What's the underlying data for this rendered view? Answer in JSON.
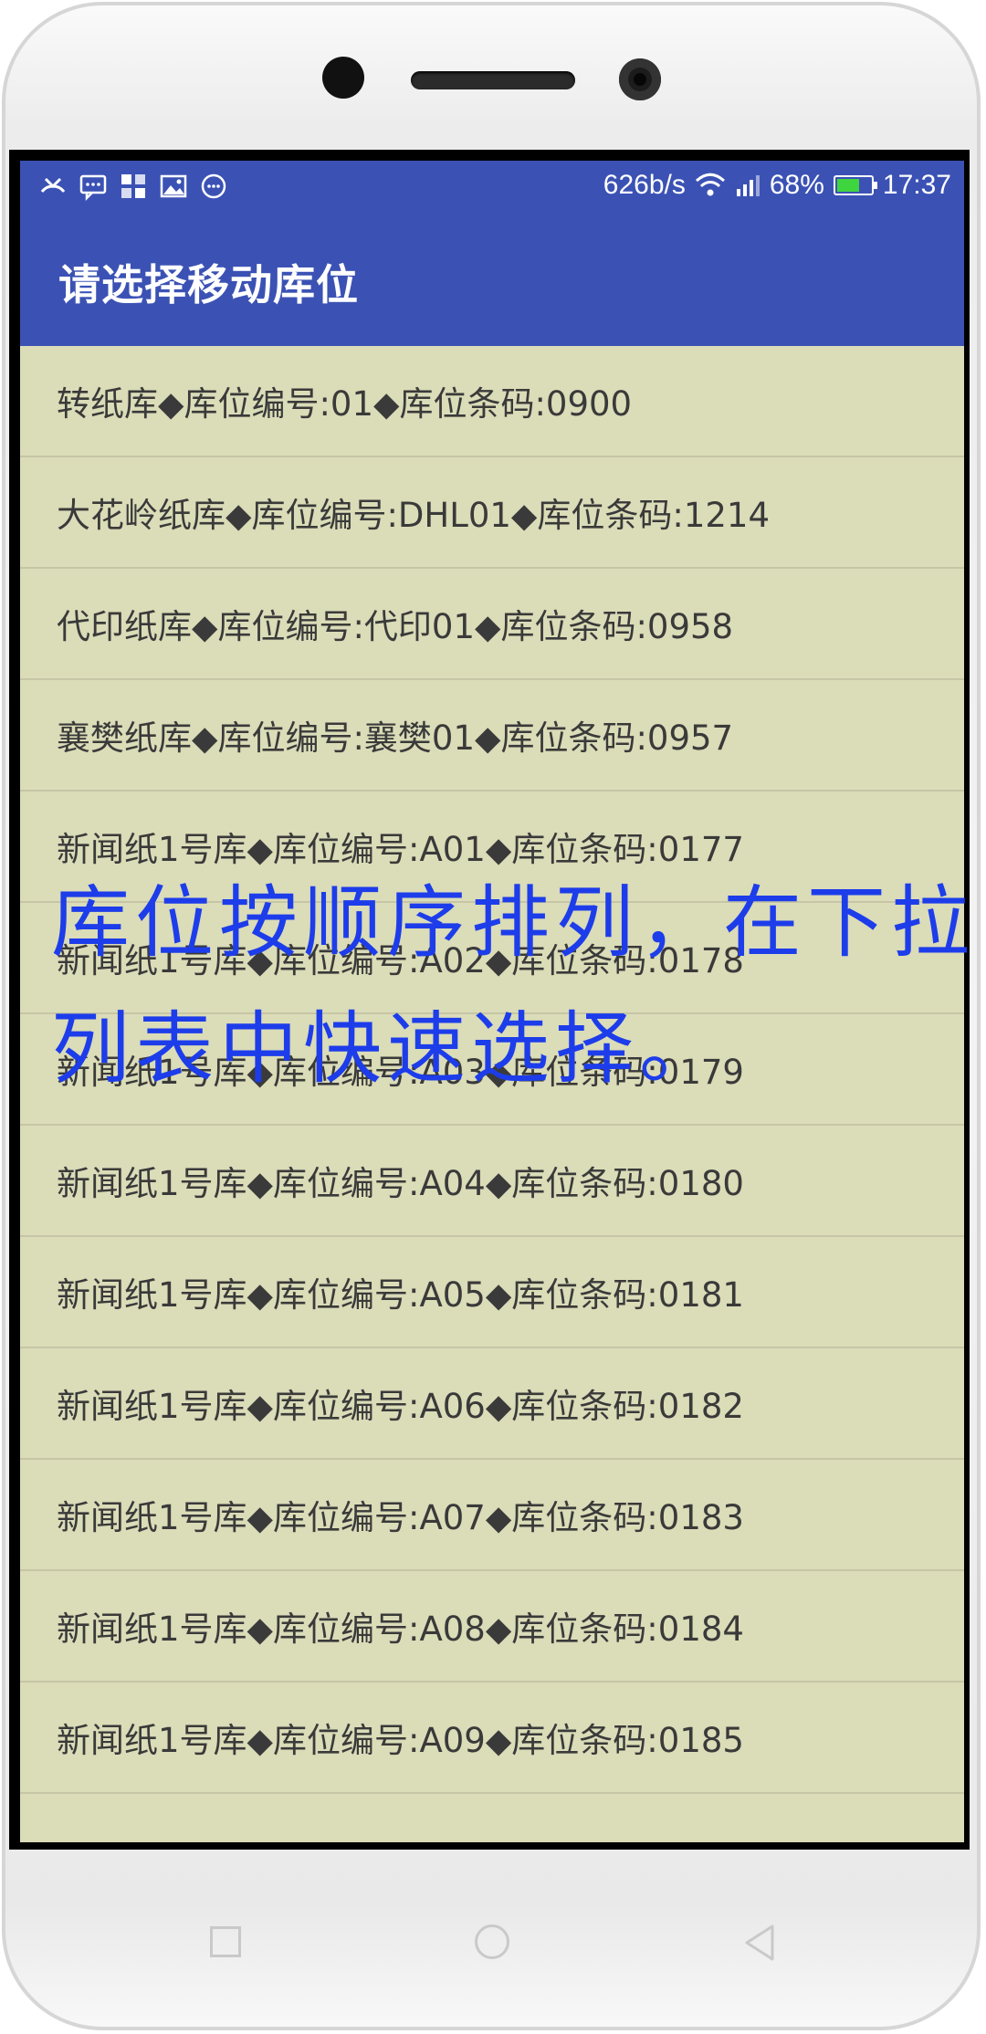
{
  "status_bar": {
    "net_speed": "626b/s",
    "battery": "68%",
    "battery_level": 0.68,
    "time": "17:37",
    "icons": [
      "missed-call-icon",
      "message-icon",
      "app-grid-icon",
      "image-icon",
      "more-icon",
      "wifi-icon",
      "signal-icon",
      "battery-icon"
    ]
  },
  "app_bar": {
    "title": "请选择移动库位"
  },
  "list": {
    "items": [
      "转纸库◆库位编号:01◆库位条码:0900",
      "大花岭纸库◆库位编号:DHL01◆库位条码:1214",
      "代印纸库◆库位编号:代印01◆库位条码:0958",
      "襄樊纸库◆库位编号:襄樊01◆库位条码:0957",
      "新闻纸1号库◆库位编号:A01◆库位条码:0177",
      "新闻纸1号库◆库位编号:A02◆库位条码:0178",
      "新闻纸1号库◆库位编号:A03◆库位条码:0179",
      "新闻纸1号库◆库位编号:A04◆库位条码:0180",
      "新闻纸1号库◆库位编号:A05◆库位条码:0181",
      "新闻纸1号库◆库位编号:A06◆库位条码:0182",
      "新闻纸1号库◆库位编号:A07◆库位条码:0183",
      "新闻纸1号库◆库位编号:A08◆库位条码:0184",
      "新闻纸1号库◆库位编号:A09◆库位条码:0185",
      ""
    ]
  },
  "overlay": {
    "line1": "库位按顺序排列，在下拉",
    "line2": "列表中快速选择。"
  },
  "colors": {
    "app_bar": "#3b52b4",
    "list_background": "#dbdcb8",
    "overlay_text": "#1d3dea",
    "battery_fill": "#3fd53f"
  }
}
